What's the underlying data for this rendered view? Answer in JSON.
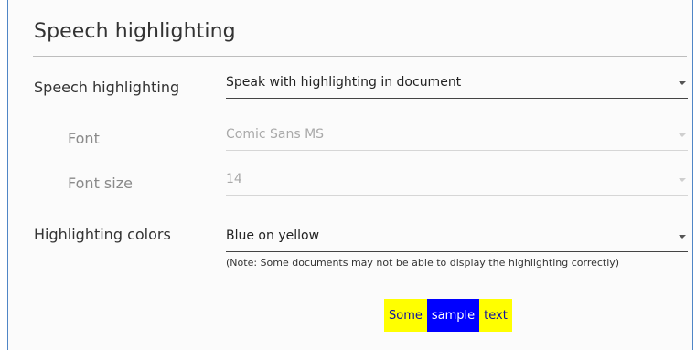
{
  "section": {
    "title": "Speech highlighting"
  },
  "settings": {
    "speech_highlighting": {
      "label": "Speech highlighting",
      "value": "Speak with highlighting in document",
      "enabled": true
    },
    "font": {
      "label": "Font",
      "value": "Comic Sans MS",
      "enabled": false
    },
    "font_size": {
      "label": "Font size",
      "value": "14",
      "enabled": false
    },
    "highlighting_colors": {
      "label": "Highlighting colors",
      "value": "Blue on yellow",
      "enabled": true,
      "note": "(Note: Some documents may not be able to display the highlighting correctly)"
    }
  },
  "preview": {
    "words": [
      "Some",
      "sample",
      "text"
    ],
    "highlight_background": "#ffff00",
    "highlight_text": "#1010a0",
    "active_background": "#0000ff",
    "active_text": "#ffffff"
  },
  "colors": {
    "panel_border": "#4f86c6"
  }
}
